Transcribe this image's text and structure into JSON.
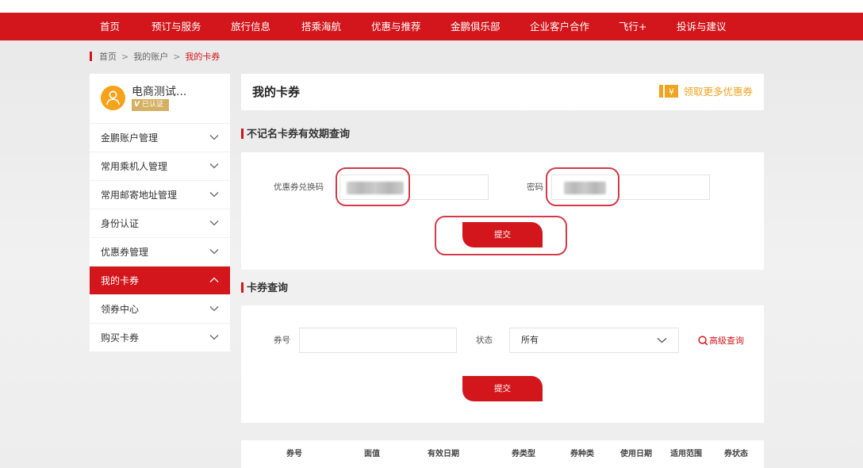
{
  "nav": {
    "items": [
      "首页",
      "预订与服务",
      "旅行信息",
      "搭乘海航",
      "优惠与推荐",
      "金鹏俱乐部",
      "企业客户合作",
      "飞行+",
      "投诉与建议"
    ]
  },
  "breadcrumb": {
    "items": [
      "首页",
      "我的账户",
      "我的卡券"
    ],
    "separator": ">"
  },
  "profile": {
    "username": "电商测试...",
    "verified_mark": "V",
    "verified_label": "已认证"
  },
  "sidebar": {
    "items": [
      {
        "label": "金鹏账户管理",
        "icon": "chevron-down-icon",
        "active": false
      },
      {
        "label": "常用乘机人管理",
        "icon": "chevron-down-icon",
        "active": false
      },
      {
        "label": "常用邮寄地址管理",
        "icon": "chevron-down-icon",
        "active": false
      },
      {
        "label": "身份认证",
        "icon": "chevron-down-icon",
        "active": false
      },
      {
        "label": "优惠券管理",
        "icon": "chevron-down-icon",
        "active": false
      },
      {
        "label": "我的卡券",
        "icon": "chevron-up-icon",
        "active": true
      },
      {
        "label": "领券中心",
        "icon": "chevron-down-icon",
        "active": false
      },
      {
        "label": "购买卡券",
        "icon": "chevron-down-icon",
        "active": false
      }
    ]
  },
  "page": {
    "title": "我的卡券",
    "more_coupons": "领取更多优惠券",
    "coupon_icon_text": "¥"
  },
  "section1": {
    "title": "不记名卡券有效期查询",
    "code_label": "优惠券兑换码",
    "password_label": "密码",
    "submit_label": "提交"
  },
  "section2": {
    "title": "卡券查询",
    "number_label": "券号",
    "status_label": "状态",
    "status_value": "所有",
    "advanced_label": "高级查询",
    "submit_label": "提交"
  },
  "table": {
    "headers": [
      "券号",
      "面值",
      "有效日期",
      "券类型",
      "券种类",
      "使用日期",
      "适用范围",
      "券状态"
    ]
  },
  "colors": {
    "brand_red": "#d3161b",
    "highlight_red": "#d33b49",
    "accent_orange": "#f0a31e",
    "avatar_orange": "#f5a31a",
    "verified_gold": "#d5b062"
  }
}
